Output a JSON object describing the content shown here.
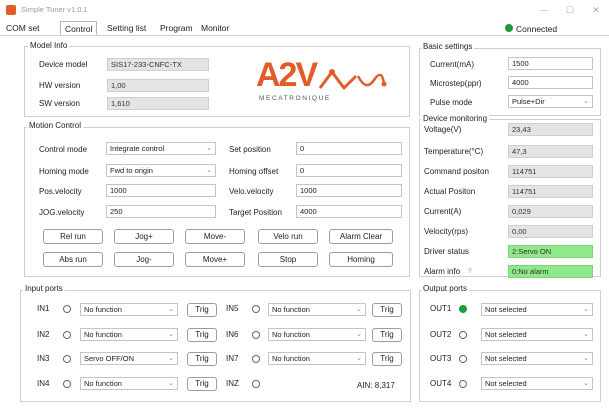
{
  "window": {
    "title": "Simple Tuner v1.0.1",
    "min_glyph": "—",
    "max_glyph": "☐",
    "close_glyph": "✕"
  },
  "tabs": [
    "COM set",
    "Control",
    "Setting list",
    "Program",
    "Monitor"
  ],
  "active_tab": "Control",
  "status": {
    "text": "Connected",
    "color": "#1a9e3c"
  },
  "model_info": {
    "title": "Model Info",
    "device_model_label": "Device model",
    "device_model": "SIS17-233-CNFC-TX",
    "hw_label": "HW version",
    "hw": "1,00",
    "sw_label": "SW version",
    "sw": "1,610"
  },
  "logo": {
    "text": "A2V",
    "subtitle": "MECATRONIQUE",
    "color": "#e25c2a"
  },
  "basic_settings": {
    "title": "Basic settings",
    "current_label": "Current(mA)",
    "current": "1500",
    "microstep_label": "Microstep(ppr)",
    "microstep": "4000",
    "pulse_mode_label": "Pulse mode",
    "pulse_mode": "Pulse+Dir"
  },
  "motion": {
    "title": "Motion Control",
    "control_mode_label": "Control mode",
    "control_mode": "Integrate control",
    "homing_mode_label": "Homing mode",
    "homing_mode": "Fwd to origin",
    "pos_velocity_label": "Pos.velocity",
    "pos_velocity": "1000",
    "jog_velocity_label": "JOG.velocity",
    "jog_velocity": "250",
    "set_position_label": "Set position",
    "set_position": "0",
    "homing_offset_label": "Homing offset",
    "homing_offset": "0",
    "velo_velocity_label": "Velo.velocity",
    "velo_velocity": "1000",
    "target_position_label": "Target Position",
    "target_position": "4000",
    "buttons": {
      "rel_run": "Rel run",
      "jog_plus": "Jog+",
      "move_minus": "Move-",
      "velo_run": "Velo run",
      "alarm_clear": "Alarm Clear",
      "abs_run": "Abs run",
      "jog_minus": "Jog-",
      "move_plus": "Move+",
      "stop": "Stop",
      "homing": "Homing"
    }
  },
  "monitoring": {
    "title": "Device monitoring",
    "voltage_label": "Voltage(V)",
    "voltage": "23,43",
    "temperature_label": "Temperature(°C)",
    "temperature": "47,3",
    "command_position_label": "Command positon",
    "command_position": "114751",
    "actual_position_label": "Actual Positon",
    "actual_position": "114751",
    "current_label": "Current(A)",
    "current": "0,029",
    "velocity_label": "Velocity(rps)",
    "velocity": "0,00",
    "driver_status_label": "Driver status",
    "driver_status": "2:Servo ON",
    "alarm_info_label": "Alarm info",
    "alarm_info_hint": "?",
    "alarm_info": "0:No alarm",
    "ok_color": "#8fe88a"
  },
  "input_ports": {
    "title": "Input ports",
    "trig_label": "Trig",
    "ports": [
      {
        "name": "IN1",
        "value": "No function"
      },
      {
        "name": "IN2",
        "value": "No function"
      },
      {
        "name": "IN3",
        "value": "Servo OFF/ON"
      },
      {
        "name": "IN4",
        "value": "No function"
      },
      {
        "name": "IN5",
        "value": "No function"
      },
      {
        "name": "IN6",
        "value": "No function"
      },
      {
        "name": "IN7",
        "value": "No function"
      },
      {
        "name": "INZ",
        "value": ""
      }
    ],
    "ain": "AIN: 8,317"
  },
  "output_ports": {
    "title": "Output ports",
    "ports": [
      {
        "name": "OUT1",
        "value": "Not selected",
        "active": true
      },
      {
        "name": "OUT2",
        "value": "Not selected",
        "active": false
      },
      {
        "name": "OUT3",
        "value": "Not selected",
        "active": false
      },
      {
        "name": "OUT4",
        "value": "Not selected",
        "active": false
      }
    ]
  }
}
